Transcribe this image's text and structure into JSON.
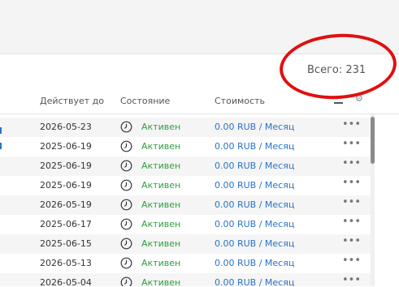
{
  "summary": {
    "total_label": "Всего: 231"
  },
  "table": {
    "columns": {
      "valid_until": "Действует до",
      "state": "Состояние",
      "cost": "Стоимость"
    },
    "rows": [
      {
        "date": "2026-05-23",
        "status": "Активен",
        "price": "0.00 RUB / Месяц",
        "more": "•••"
      },
      {
        "date": "2025-06-19",
        "status": "Активен",
        "price": "0.00 RUB / Месяц",
        "more": "•••"
      },
      {
        "date": "2025-06-19",
        "status": "Активен",
        "price": "0.00 RUB / Месяц",
        "more": "•••"
      },
      {
        "date": "2025-06-19",
        "status": "Активен",
        "price": "0.00 RUB / Месяц",
        "more": "•••"
      },
      {
        "date": "2026-05-19",
        "status": "Активен",
        "price": "0.00 RUB / Месяц",
        "more": "•••"
      },
      {
        "date": "2025-06-17",
        "status": "Активен",
        "price": "0.00 RUB / Месяц",
        "more": "•••"
      },
      {
        "date": "2025-06-15",
        "status": "Активен",
        "price": "0.00 RUB / Месяц",
        "more": "•••"
      },
      {
        "date": "2026-05-13",
        "status": "Активен",
        "price": "0.00 RUB / Месяц",
        "more": "•••"
      },
      {
        "date": "2026-05-04",
        "status": "Активен",
        "price": "0.00 RUB / Месяц",
        "more": "•••"
      }
    ]
  },
  "colors": {
    "status_active": "#2e9e3e",
    "price_link": "#2a72c8",
    "highlight_ellipse": "#e01010"
  },
  "icons": {
    "clock": "clock-icon",
    "menu": "menu-icon",
    "settings": "gear-icon",
    "more": "more-icon"
  }
}
